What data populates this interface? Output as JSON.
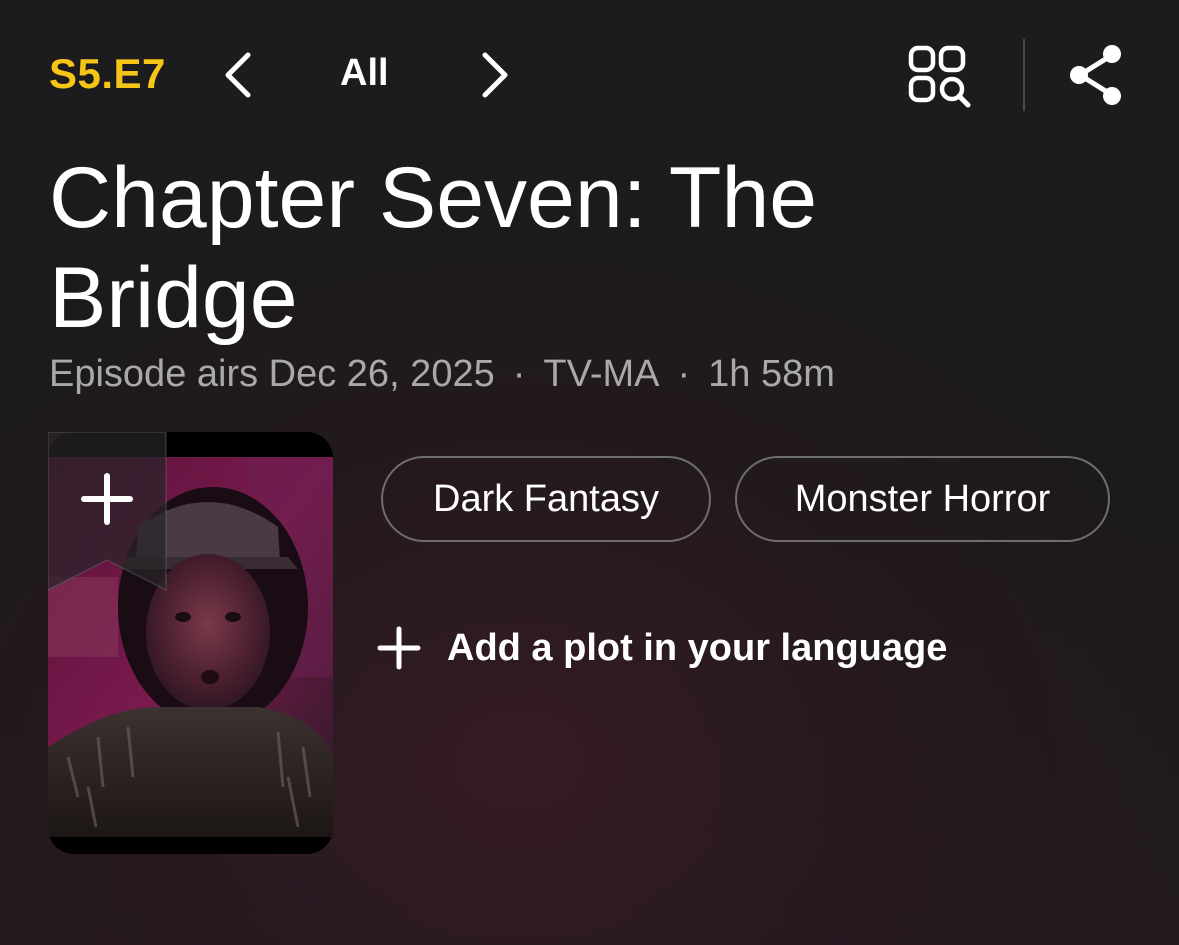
{
  "header": {
    "episode_code": "S5.E7",
    "all_label": "All",
    "prev_icon": "chevron-left-icon",
    "next_icon": "chevron-right-icon",
    "browse_icon": "episode-browse-search-icon",
    "share_icon": "share-icon"
  },
  "episode": {
    "title": "Chapter Seven: The Bridge",
    "airs": "Episode airs Dec 26, 2025",
    "separator": "·",
    "rating": "TV-MA",
    "runtime": "1h 58m"
  },
  "poster": {
    "watchlist_icon": "plus-icon"
  },
  "genres": [
    "Dark Fantasy",
    "Monster Horror"
  ],
  "plot": {
    "add_label": "Add a plot in your language",
    "icon": "plus-icon"
  },
  "colors": {
    "accent": "#f5c518",
    "background": "#1c1b1d",
    "muted_text": "#a9a9ab",
    "chip_border": "#6e6d70"
  }
}
